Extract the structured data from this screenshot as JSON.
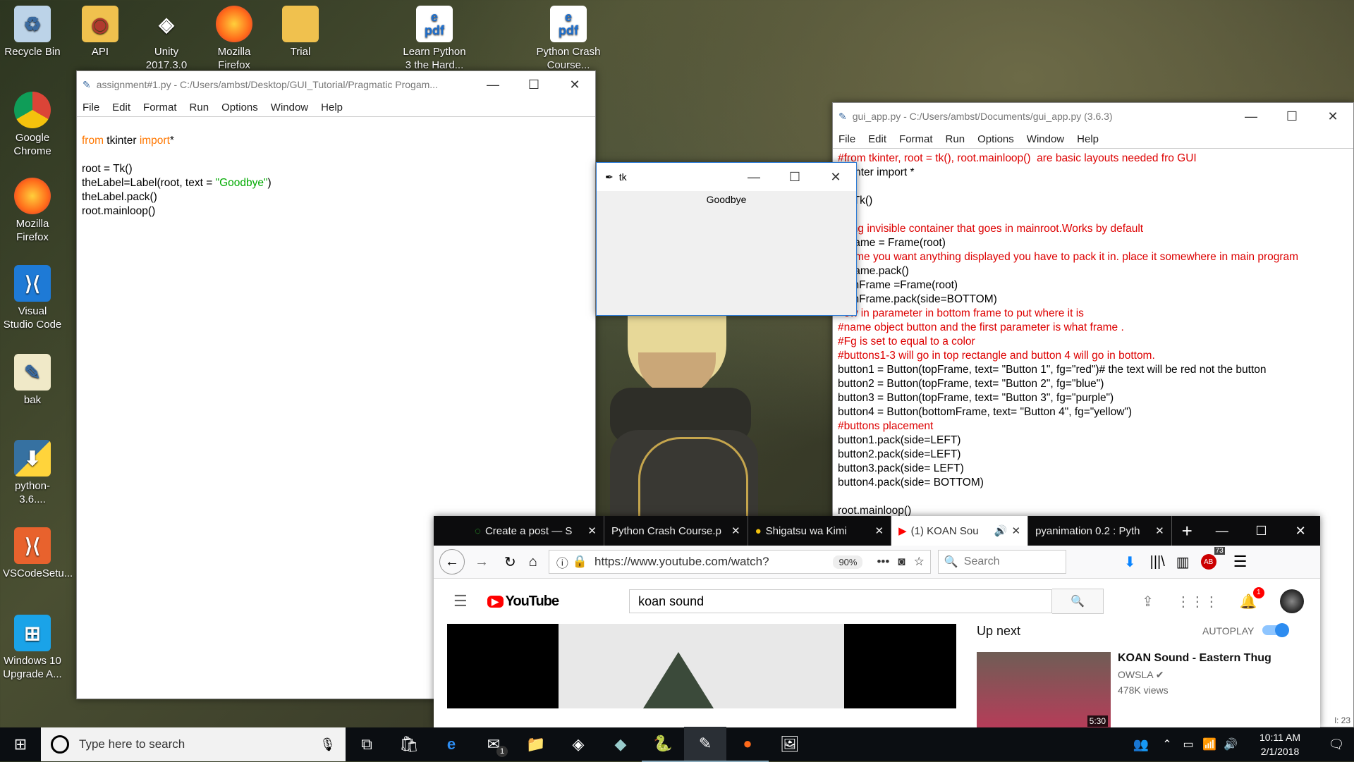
{
  "desktop": {
    "icons": [
      {
        "label": "Recycle Bin",
        "icon": "recycle-bin-icon"
      },
      {
        "label": "API",
        "icon": "folder-icon"
      },
      {
        "label": "Unity 2017.3.0",
        "icon": "unity-icon"
      },
      {
        "label": "Mozilla Firefox",
        "icon": "firefox-icon"
      },
      {
        "label": "Trial",
        "icon": "folder-icon"
      },
      {
        "label": "Learn Python 3 the Hard...",
        "icon": "pdf-icon"
      },
      {
        "label": "Python Crash Course...",
        "icon": "pdf-icon"
      },
      {
        "label": "Google Chrome",
        "icon": "chrome-icon"
      },
      {
        "label": "Mozilla Firefox",
        "icon": "firefox-icon"
      },
      {
        "label": "Visual Studio Code",
        "icon": "vscode-icon"
      },
      {
        "label": "bak",
        "icon": "file-icon"
      },
      {
        "label": "python-3.6....",
        "icon": "python-installer-icon"
      },
      {
        "label": "VSCodeSetu...",
        "icon": "vscode-setup-icon"
      },
      {
        "label": "Windows 10 Upgrade A...",
        "icon": "windows-icon"
      }
    ]
  },
  "idle1": {
    "title": "assignment#1.py - C:/Users/ambst/Desktop/GUI_Tutorial/Pragmatic Progam...",
    "menu": [
      "File",
      "Edit",
      "Format",
      "Run",
      "Options",
      "Window",
      "Help"
    ],
    "code": {
      "l1_kw1": "from",
      "l1_mid": " tkinter ",
      "l1_kw2": "import",
      "l1_end": "*",
      "l2": "root = Tk()",
      "l3_a": "theLabel=Label(root, text = ",
      "l3_str": "\"Goodbye\"",
      "l3_b": ")",
      "l4": "theLabel.pack()",
      "l5": "root.mainloop()"
    }
  },
  "tk": {
    "title": "tk",
    "label": "Goodbye"
  },
  "idle2": {
    "title": "gui_app.py - C:/Users/ambst/Documents/gui_app.py (3.6.3)",
    "menu": [
      "File",
      "Edit",
      "Format",
      "Run",
      "Options",
      "Window",
      "Help"
    ],
    "lines": [
      {
        "t": "#from tkinter, root = tk(), root.mainloop()  are basic layouts needed fro GUI",
        "c": "cm"
      },
      {
        "t": "  tkinter import *",
        "c": "mix"
      },
      {
        "t": "",
        "c": ""
      },
      {
        "t": "  = Tk()",
        "c": ""
      },
      {
        "t": "",
        "c": ""
      },
      {
        "t": "  king invisible container that goes in mainroot.Works by default",
        "c": "cm"
      },
      {
        "t": "  Frame = Frame(root)",
        "c": ""
      },
      {
        "t": "  ytime you want anything displayed you have to pack it in. place it somewhere in main program",
        "c": "cm"
      },
      {
        "t": "  Frame.pack()",
        "c": ""
      },
      {
        "t": "  omFrame =Frame(root)",
        "c": ""
      },
      {
        "t": "  omFrame.pack(side=BOTTOM)",
        "c": ""
      },
      {
        "t": "  ow in parameter in bottom frame to put where it is",
        "c": "cm"
      },
      {
        "t": "#name object button and the first parameter is what frame .",
        "c": "cm"
      },
      {
        "t": "#Fg is set to equal to a color",
        "c": "cm"
      },
      {
        "t": "#buttons1-3 will go in top rectangle and button 4 will go in bottom.",
        "c": "cm"
      },
      {
        "t": "button1 = Button(topFrame, text= \"Button 1\", fg=\"red\")# the text will be red not the button",
        "c": "b1"
      },
      {
        "t": "button2 = Button(topFrame, text= \"Button 2\", fg=\"blue\")",
        "c": "b"
      },
      {
        "t": "button3 = Button(topFrame, text= \"Button 3\", fg=\"purple\")",
        "c": "b"
      },
      {
        "t": "button4 = Button(bottomFrame, text= \"Button 4\", fg=\"yellow\")",
        "c": "b"
      },
      {
        "t": "#buttons placement",
        "c": "cm"
      },
      {
        "t": "button1.pack(side=LEFT)",
        "c": ""
      },
      {
        "t": "button2.pack(side=LEFT)",
        "c": ""
      },
      {
        "t": "button3.pack(side= LEFT)",
        "c": ""
      },
      {
        "t": "button4.pack(side= BOTTOM)",
        "c": ""
      },
      {
        "t": "",
        "c": ""
      },
      {
        "t": "root.mainloop()",
        "c": ""
      }
    ],
    "status": "l: 23"
  },
  "firefox": {
    "tabs": [
      {
        "label": "Create a post — S",
        "icon": "spinner-icon"
      },
      {
        "label": "Python Crash Course.p",
        "icon": ""
      },
      {
        "label": "Shigatsu wa Kimi",
        "icon": "chrome-like-icon"
      },
      {
        "label": "(1) KOAN Sou",
        "icon": "youtube-icon"
      },
      {
        "label": "pyanimation 0.2 : Pyth",
        "icon": ""
      }
    ],
    "url": "https://www.youtube.com/watch?",
    "zoom": "90%",
    "search_placeholder": "Search",
    "badge_count": "73"
  },
  "youtube": {
    "logo": "YouTube",
    "search_value": "koan sound",
    "notif_count": "1",
    "up_next": "Up next",
    "autoplay": "AUTOPLAY",
    "video_title": "KOAN Sound - Eastern Thug",
    "channel": "OWSLA",
    "views": "478K views",
    "duration": "5:30"
  },
  "taskbar": {
    "search_placeholder": "Type here to search",
    "time": "10:11 AM",
    "date": "2/1/2018",
    "mail_badge": "1"
  }
}
